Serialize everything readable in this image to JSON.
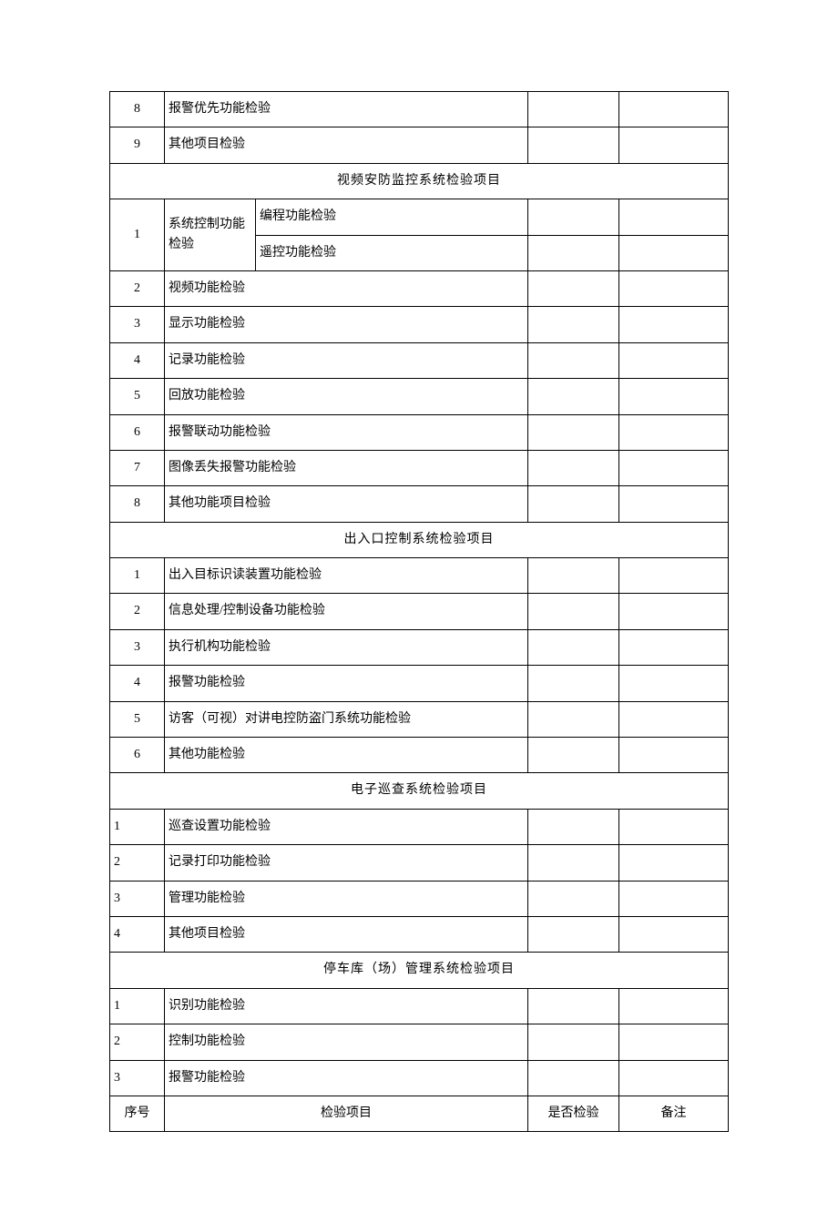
{
  "top_rows": [
    {
      "num": "8",
      "name": "报警优先功能检验"
    },
    {
      "num": "9",
      "name": "其他项目检验"
    }
  ],
  "sections": {
    "video": {
      "title": "视频安防监控系统检验项目",
      "row1_num": "1",
      "row1_group": "系统控制功能检验",
      "row1_sub1": "编程功能检验",
      "row1_sub2": "遥控功能检验",
      "rows": [
        {
          "num": "2",
          "name": "视频功能检验"
        },
        {
          "num": "3",
          "name": "显示功能检验"
        },
        {
          "num": "4",
          "name": "记录功能检验"
        },
        {
          "num": "5",
          "name": "回放功能检验"
        },
        {
          "num": "6",
          "name": "报警联动功能检验"
        },
        {
          "num": "7",
          "name": "图像丢失报警功能检验"
        },
        {
          "num": "8",
          "name": "其他功能项目检验"
        }
      ]
    },
    "access": {
      "title": "出入口控制系统检验项目",
      "rows": [
        {
          "num": "1",
          "name": "出入目标识读装置功能检验"
        },
        {
          "num": "2",
          "name": "信息处理/控制设备功能检验"
        },
        {
          "num": "3",
          "name": "执行机构功能检验"
        },
        {
          "num": "4",
          "name": "报警功能检验"
        },
        {
          "num": "5",
          "name": "访客（可视）对讲电控防盗门系统功能检验"
        },
        {
          "num": "6",
          "name": "其他功能检验"
        }
      ]
    },
    "patrol": {
      "title": "电子巡查系统检验项目",
      "rows": [
        {
          "num": "1",
          "name": "巡查设置功能检验"
        },
        {
          "num": "2",
          "name": "记录打印功能检验"
        },
        {
          "num": "3",
          "name": "管理功能检验"
        },
        {
          "num": "4",
          "name": "其他项目检验"
        }
      ]
    },
    "parking": {
      "title": "停车库（场）管理系统检验项目",
      "rows": [
        {
          "num": "1",
          "name": "识别功能检验"
        },
        {
          "num": "2",
          "name": "控制功能检验"
        },
        {
          "num": "3",
          "name": "报警功能检验"
        }
      ]
    }
  },
  "footer_header": {
    "col1": "序号",
    "col2": "检验项目",
    "col3": "是否检验",
    "col4": "备注"
  }
}
